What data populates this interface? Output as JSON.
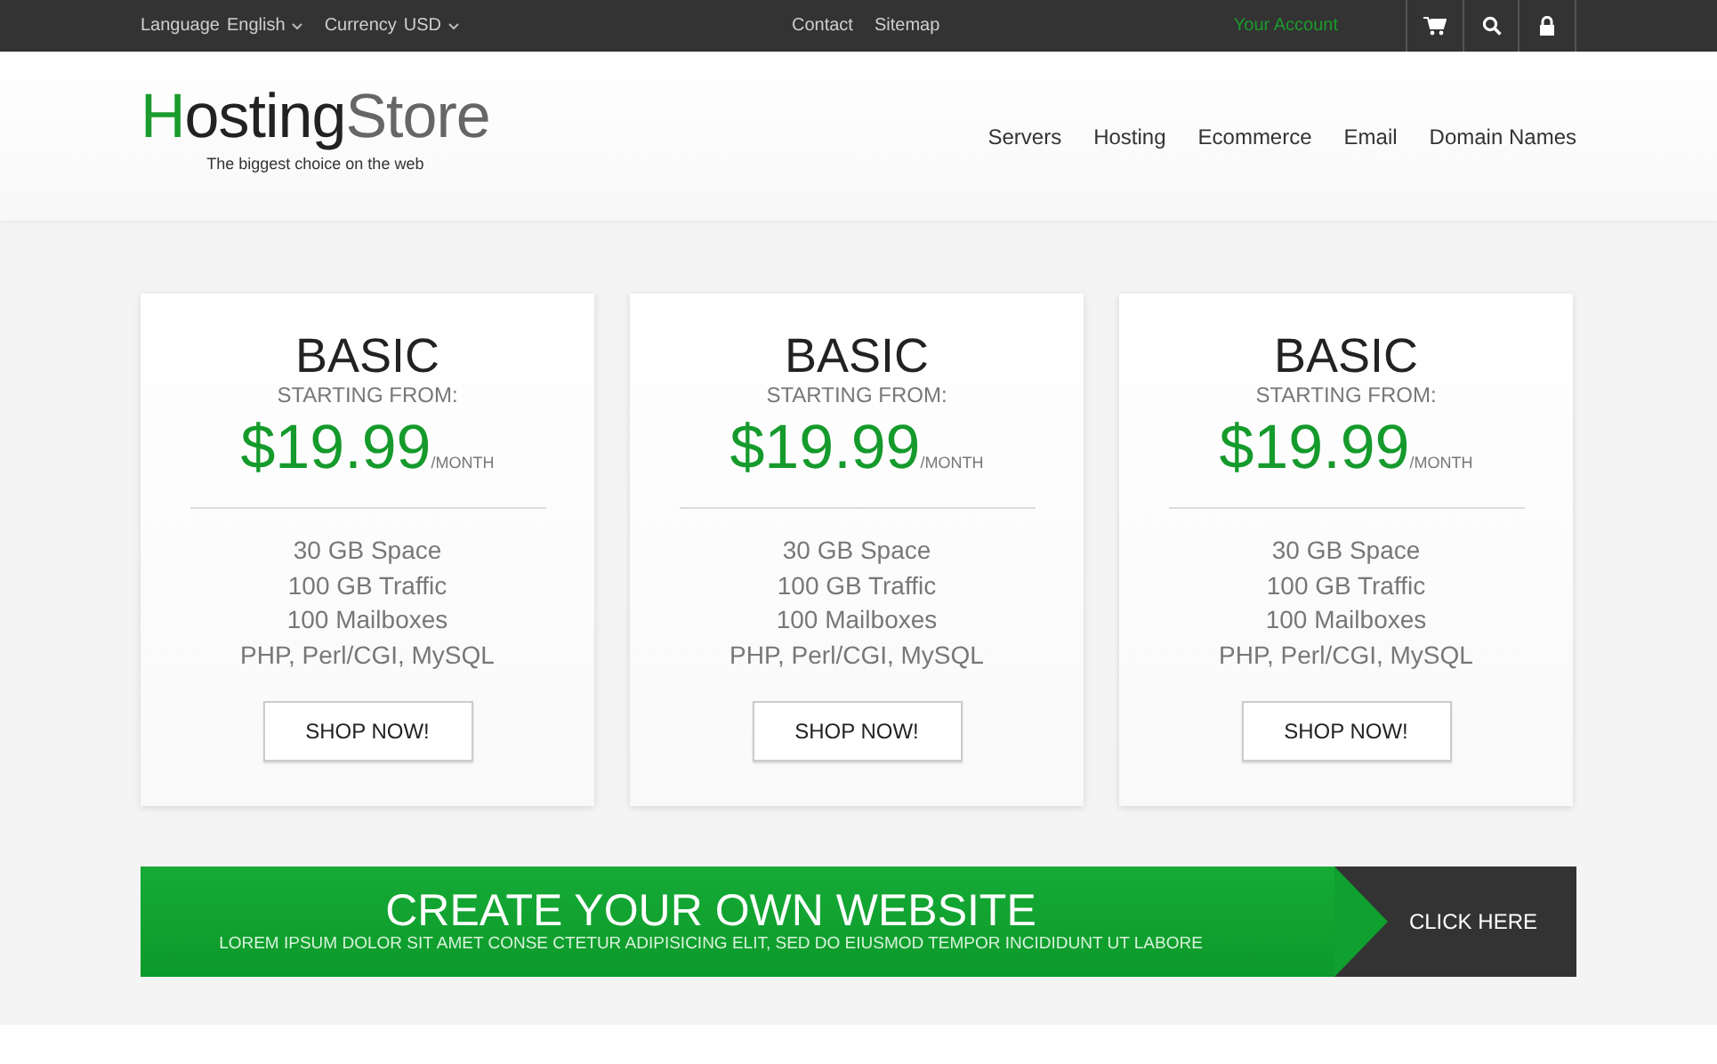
{
  "top_bar": {
    "language": {
      "label": "Language",
      "value": "English"
    },
    "currency": {
      "label": "Currency",
      "value": "USD"
    },
    "links": [
      "Contact",
      "Sitemap"
    ],
    "account": "Your Account"
  },
  "logo": {
    "parts": [
      "H",
      "osting",
      "Store"
    ],
    "tagline": "The biggest choice on the web"
  },
  "nav": [
    "Servers",
    "Hosting",
    "Ecommerce",
    "Email",
    "Domain Names"
  ],
  "plans": [
    {
      "name": "BASIC",
      "starting": "STARTING FROM:",
      "price": "$19.99",
      "period": "/MONTH",
      "features": [
        "30 GB Space",
        "100 GB Traffic",
        "100 Mailboxes",
        "PHP, Perl/CGI, MySQL"
      ],
      "button": "SHOP NOW!"
    },
    {
      "name": "BASIC",
      "starting": "STARTING FROM:",
      "price": "$19.99",
      "period": "/MONTH",
      "features": [
        "30 GB Space",
        "100 GB Traffic",
        "100 Mailboxes",
        "PHP, Perl/CGI, MySQL"
      ],
      "button": "SHOP NOW!"
    },
    {
      "name": "BASIC",
      "starting": "STARTING FROM:",
      "price": "$19.99",
      "period": "/MONTH",
      "features": [
        "30 GB Space",
        "100 GB Traffic",
        "100 Mailboxes",
        "PHP, Perl/CGI, MySQL"
      ],
      "button": "SHOP NOW!"
    }
  ],
  "banner": {
    "title": "CREATE YOUR OWN WEBSITE",
    "subtitle": "LOREM IPSUM DOLOR SIT AMET CONSE CTETUR ADIPISICING ELIT, SED DO EIUSMOD TEMPOR INCIDIDUNT UT LABORE",
    "button": "CLICK HERE"
  }
}
